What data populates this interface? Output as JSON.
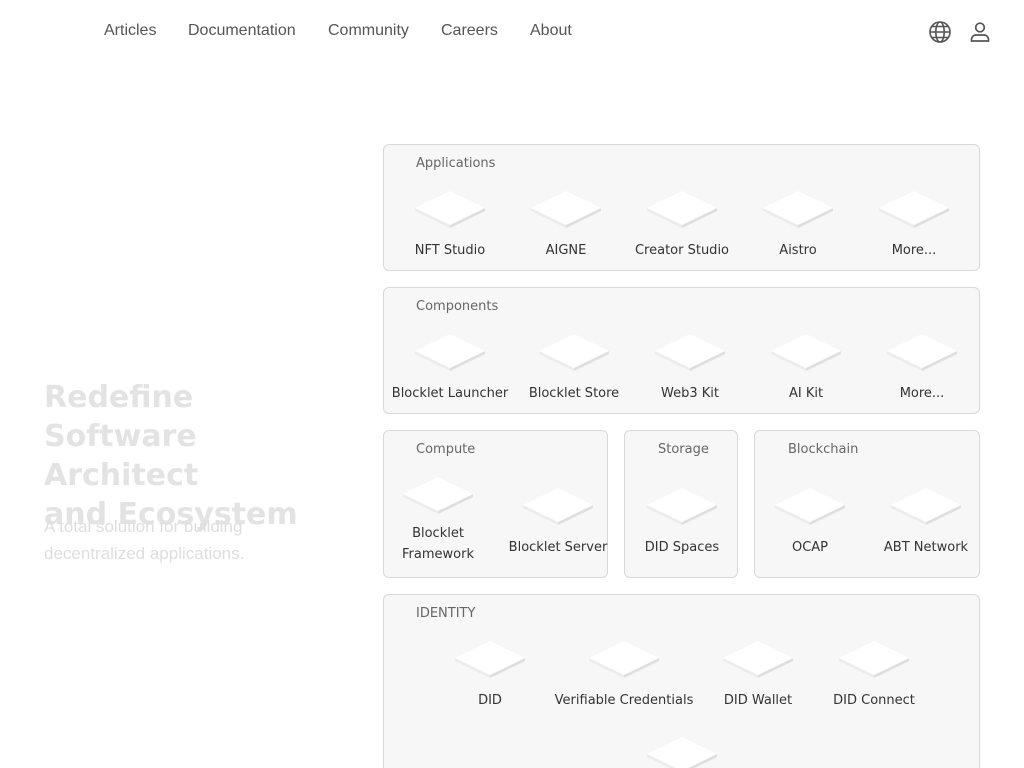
{
  "nav": {
    "links": [
      "Articles",
      "Documentation",
      "Community",
      "Careers",
      "About"
    ],
    "icons": [
      "globe-icon",
      "user-icon"
    ]
  },
  "hero": {
    "title": "Redefine Software Architect\nand Ecosystem",
    "subtitle": "A total solution for building decentralized applications."
  },
  "sections": {
    "applications": {
      "title": "Applications",
      "items": [
        "NFT Studio",
        "AIGNE",
        "Creator Studio",
        "Aistro",
        "More..."
      ]
    },
    "components": {
      "title": "Components",
      "items": [
        "Blocklet Launcher",
        "Blocklet Store",
        "Web3 Kit",
        "AI Kit",
        "More..."
      ]
    },
    "compute": {
      "title": "Compute",
      "items": [
        "Blocklet Framework",
        "Blocklet Server"
      ]
    },
    "storage": {
      "title": "Storage",
      "items": [
        "DID Spaces"
      ]
    },
    "blockchain": {
      "title": "Blockchain",
      "items": [
        "OCAP",
        "ABT Network"
      ]
    },
    "identity": {
      "title": "IDENTITY",
      "items": [
        "DID",
        "Verifiable Credentials",
        "DID Wallet",
        "DID Connect",
        ""
      ]
    }
  },
  "colors": {
    "tile_top": "#ffffff",
    "tile_left": "#ececec",
    "tile_right": "#dedede",
    "box_bg": "#f7f7f7",
    "box_border": "#d9d9d9",
    "hero_text": "#e3e3e3"
  }
}
